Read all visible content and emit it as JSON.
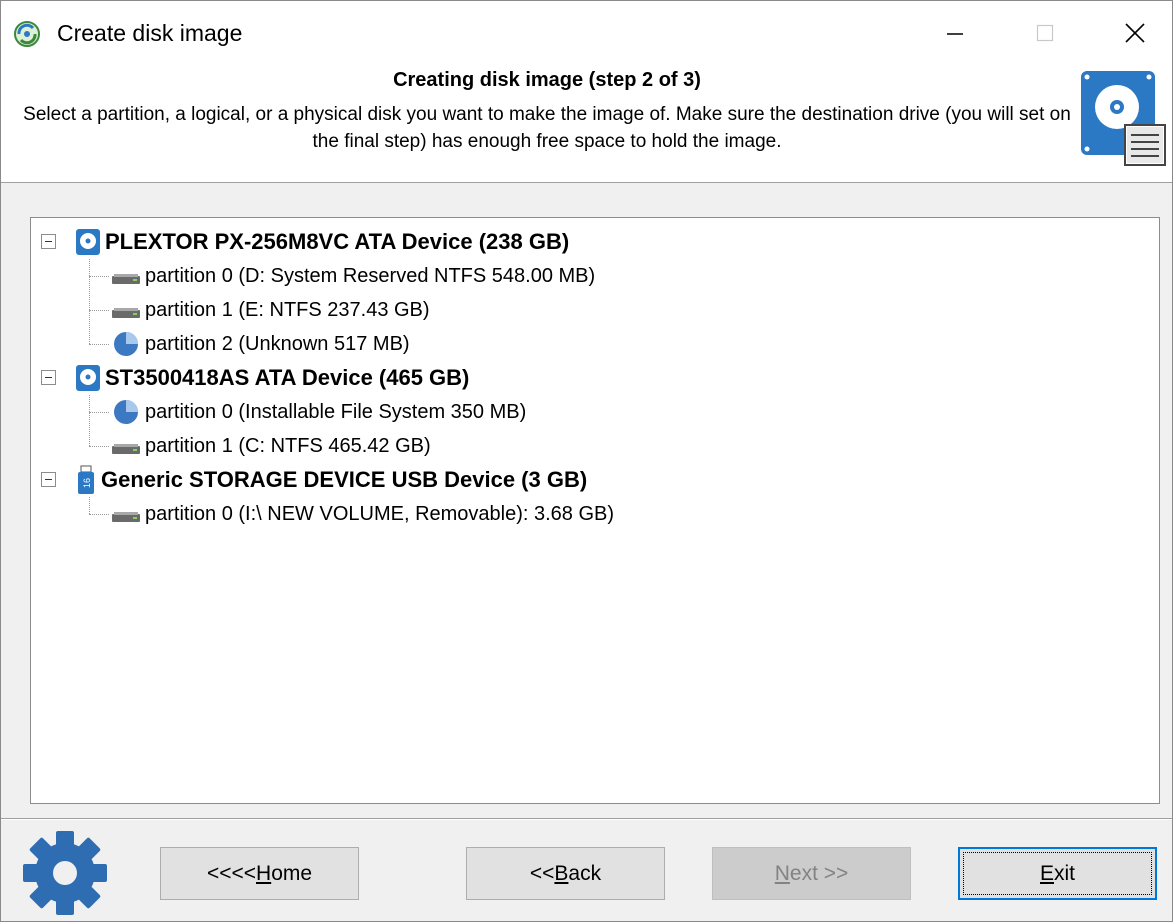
{
  "window": {
    "title": "Create disk image",
    "app_icon": "disk-image-app-icon",
    "controls": {
      "minimize": "minimize-icon",
      "maximize": "maximize-icon",
      "close": "close-icon"
    }
  },
  "header": {
    "title": "Creating disk image (step 2 of 3)",
    "description": "Select a partition, a logical, or a physical disk you want to make the image of. Make sure the destination drive (you will set on the final step) has enough free space to hold the image.",
    "icon": "disk-image-icon"
  },
  "tree": {
    "disks": [
      {
        "label": "PLEXTOR PX-256M8VC ATA Device (238 GB)",
        "icon": "hard-disk-icon",
        "expanded": true,
        "partitions": [
          {
            "label": "partition 0 (D: System Reserved NTFS 548.00 MB)",
            "icon": "drive-icon"
          },
          {
            "label": "partition 1 (E: NTFS 237.43 GB)",
            "icon": "drive-icon"
          },
          {
            "label": "partition 2 (Unknown 517 MB)",
            "icon": "pie-partition-icon"
          }
        ]
      },
      {
        "label": "ST3500418AS ATA Device (465 GB)",
        "icon": "hard-disk-icon",
        "expanded": true,
        "partitions": [
          {
            "label": "partition 0 (Installable File System 350 MB)",
            "icon": "pie-partition-icon"
          },
          {
            "label": "partition 1 (C: NTFS 465.42 GB)",
            "icon": "drive-icon"
          }
        ]
      },
      {
        "label": "Generic STORAGE DEVICE USB Device (3 GB)",
        "icon": "usb-drive-icon",
        "usb_icon_text": "16",
        "expanded": true,
        "partitions": [
          {
            "label": "partition 0 (I:\\  NEW VOLUME, Removable):  3.68 GB)",
            "icon": "drive-icon"
          }
        ]
      }
    ]
  },
  "footer": {
    "icon": "gear-icon",
    "buttons": {
      "home": {
        "prefix": "<<<< ",
        "mnemonic": "H",
        "rest": "ome",
        "enabled": true
      },
      "back": {
        "prefix": "<< ",
        "mnemonic": "B",
        "rest": "ack",
        "enabled": true
      },
      "next": {
        "prefix": "",
        "mnemonic": "N",
        "rest": "ext >>",
        "enabled": false
      },
      "exit": {
        "prefix": "",
        "mnemonic": "E",
        "rest": "xit",
        "enabled": true,
        "focused": true
      }
    }
  },
  "colors": {
    "accent": "#0078d7",
    "icon_blue": "#2b78c5",
    "button_face": "#e1e1e1",
    "window_bg": "#f0f0f0"
  }
}
